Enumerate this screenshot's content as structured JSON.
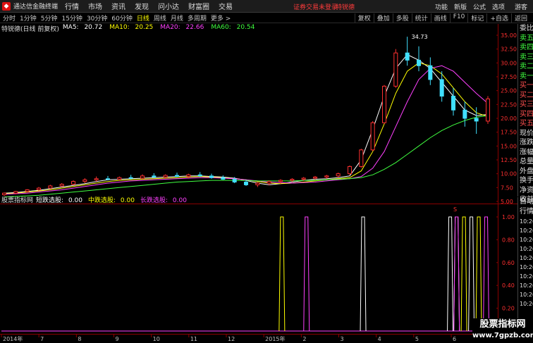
{
  "window": {
    "app_name": "通达信金融终端",
    "menu": [
      "行情",
      "市场",
      "资讯",
      "发现",
      "问小达",
      "财富圈",
      "交易"
    ],
    "notice": "证券交易未登录",
    "notice_stock": "特锐德",
    "right_menu": [
      "功能",
      "新版",
      "公式",
      "选项"
    ],
    "guest": "游客"
  },
  "toolbar": {
    "periods": [
      "分时",
      "1分钟",
      "5分钟",
      "15分钟",
      "30分钟",
      "60分钟",
      "日线",
      "周线",
      "月线",
      "多周期",
      "更多 >"
    ],
    "active_period": "日线",
    "right_tools": [
      "复权",
      "叠加",
      "多股",
      "统计",
      "画线",
      "F10",
      "标记",
      "+自选",
      "返回"
    ]
  },
  "main_chart": {
    "stock_label": "特锐德(日线 前复权)",
    "ma": [
      {
        "label": "MA5:",
        "value": "20.72",
        "color": "#ffffff"
      },
      {
        "label": "MA10:",
        "value": "20.25",
        "color": "#ffff00"
      },
      {
        "label": "MA20:",
        "value": "22.66",
        "color": "#ff40ff"
      },
      {
        "label": "MA60:",
        "value": "20.54",
        "color": "#40ff40"
      }
    ],
    "peak_label": "34.73",
    "marker_s": "S"
  },
  "indicator": {
    "name": "股票指标网",
    "items": [
      {
        "label": "短跌选股:",
        "value": "0.00",
        "color": "#ffffff"
      },
      {
        "label": "中跌选股:",
        "value": "0.00",
        "color": "#ffff00"
      },
      {
        "label": "长跌选股:",
        "value": "0.00",
        "color": "#ff40ff"
      }
    ]
  },
  "side_panel": {
    "top": [
      "委比",
      "卖五",
      "卖四",
      "卖三",
      "卖二",
      "卖一",
      "买一",
      "买二",
      "买三",
      "买四",
      "买五",
      "现价",
      "涨跌",
      "涨幅",
      "总量",
      "外盘",
      "换手",
      "净资",
      "收益"
    ],
    "bottom_title": [
      "自动",
      "行情"
    ],
    "times": [
      "10:26",
      "10:26",
      "10:26",
      "10:26",
      "10:26",
      "10:26",
      "10:26",
      "10:26",
      "10:26",
      "10:26"
    ]
  },
  "chart_data": {
    "type": "candlestick",
    "y_axis_ticks": [
      "35.00",
      "32.50",
      "30.00",
      "27.50",
      "25.00",
      "22.50",
      "20.00",
      "17.50",
      "15.00",
      "12.50",
      "10.00",
      "7.50",
      "5.00"
    ],
    "ylim": [
      5.0,
      35.0
    ],
    "indicator_y_ticks": [
      "1.00",
      "0.80",
      "0.60",
      "0.40",
      "0.20"
    ],
    "x_axis_labels": [
      "2014年",
      "7",
      "8",
      "9",
      "10",
      "11",
      "12",
      "2015年",
      "2",
      "3",
      "4",
      "5",
      "6"
    ],
    "ma_series": [
      {
        "name": "MA5",
        "color": "#ffffff",
        "values": [
          6.5,
          6.6,
          6.8,
          7.0,
          7.3,
          7.6,
          7.9,
          8.2,
          8.6,
          8.9,
          9.0,
          9.1,
          9.2,
          9.3,
          9.4,
          9.5,
          9.6,
          9.6,
          9.5,
          9.4,
          9.2,
          8.8,
          8.3,
          8.0,
          8.2,
          8.5,
          8.8,
          9.0,
          9.1,
          9.3,
          9.6,
          12.5,
          18.0,
          24.0,
          29.0,
          31.5,
          30.5,
          29.0,
          26.5,
          24.0,
          21.5,
          20.5,
          20.7
        ]
      },
      {
        "name": "MA10",
        "color": "#ffff00",
        "values": [
          6.4,
          6.5,
          6.7,
          6.9,
          7.1,
          7.4,
          7.7,
          8.0,
          8.3,
          8.6,
          8.8,
          8.9,
          9.0,
          9.1,
          9.2,
          9.3,
          9.4,
          9.5,
          9.4,
          9.3,
          9.1,
          8.9,
          8.6,
          8.3,
          8.2,
          8.3,
          8.5,
          8.7,
          8.9,
          9.1,
          9.3,
          10.5,
          14.0,
          19.0,
          24.5,
          28.5,
          30.0,
          29.5,
          28.0,
          25.5,
          23.0,
          21.0,
          20.3
        ]
      },
      {
        "name": "MA20",
        "color": "#ff40ff",
        "values": [
          6.3,
          6.4,
          6.5,
          6.7,
          6.9,
          7.1,
          7.4,
          7.7,
          8.0,
          8.3,
          8.5,
          8.7,
          8.8,
          8.9,
          9.0,
          9.1,
          9.2,
          9.3,
          9.3,
          9.2,
          9.1,
          8.9,
          8.7,
          8.5,
          8.4,
          8.3,
          8.4,
          8.5,
          8.7,
          8.9,
          9.1,
          9.5,
          11.0,
          14.0,
          18.5,
          23.0,
          27.0,
          29.0,
          29.5,
          28.5,
          26.5,
          24.5,
          22.7
        ]
      },
      {
        "name": "MA60",
        "color": "#40ff40",
        "values": [
          5.8,
          5.9,
          6.0,
          6.1,
          6.3,
          6.5,
          6.7,
          6.9,
          7.1,
          7.3,
          7.5,
          7.7,
          7.9,
          8.1,
          8.3,
          8.5,
          8.6,
          8.7,
          8.8,
          8.8,
          8.8,
          8.8,
          8.7,
          8.7,
          8.7,
          8.7,
          8.8,
          8.8,
          8.9,
          9.0,
          9.1,
          9.3,
          9.8,
          10.8,
          12.0,
          13.5,
          15.0,
          16.5,
          17.8,
          18.8,
          19.6,
          20.2,
          20.5
        ]
      }
    ],
    "candles": [
      {
        "o": 6.2,
        "h": 6.6,
        "l": 6.0,
        "c": 6.5
      },
      {
        "o": 6.5,
        "h": 6.9,
        "l": 6.3,
        "c": 6.8
      },
      {
        "o": 6.8,
        "h": 7.2,
        "l": 6.6,
        "c": 7.1
      },
      {
        "o": 7.1,
        "h": 7.6,
        "l": 6.9,
        "c": 7.4
      },
      {
        "o": 7.4,
        "h": 8.0,
        "l": 7.2,
        "c": 7.8
      },
      {
        "o": 7.8,
        "h": 8.3,
        "l": 7.6,
        "c": 8.1
      },
      {
        "o": 8.1,
        "h": 8.8,
        "l": 7.9,
        "c": 8.6
      },
      {
        "o": 8.6,
        "h": 9.2,
        "l": 8.3,
        "c": 8.9
      },
      {
        "o": 8.9,
        "h": 9.5,
        "l": 8.6,
        "c": 9.1
      },
      {
        "o": 9.1,
        "h": 9.6,
        "l": 8.8,
        "c": 9.0
      },
      {
        "o": 9.0,
        "h": 9.5,
        "l": 8.7,
        "c": 9.3
      },
      {
        "o": 9.3,
        "h": 9.8,
        "l": 9.0,
        "c": 9.2
      },
      {
        "o": 9.2,
        "h": 9.9,
        "l": 9.0,
        "c": 9.6
      },
      {
        "o": 9.6,
        "h": 10.1,
        "l": 9.2,
        "c": 9.4
      },
      {
        "o": 9.4,
        "h": 9.9,
        "l": 9.1,
        "c": 9.7
      },
      {
        "o": 9.7,
        "h": 10.2,
        "l": 9.4,
        "c": 9.5
      },
      {
        "o": 9.5,
        "h": 10.0,
        "l": 9.2,
        "c": 9.8
      },
      {
        "o": 9.8,
        "h": 10.3,
        "l": 9.4,
        "c": 9.6
      },
      {
        "o": 9.6,
        "h": 10.0,
        "l": 9.1,
        "c": 9.3
      },
      {
        "o": 9.3,
        "h": 9.7,
        "l": 8.9,
        "c": 9.0
      },
      {
        "o": 9.0,
        "h": 9.4,
        "l": 8.3,
        "c": 8.5
      },
      {
        "o": 8.5,
        "h": 8.9,
        "l": 7.8,
        "c": 8.0
      },
      {
        "o": 8.0,
        "h": 8.5,
        "l": 7.6,
        "c": 8.3
      },
      {
        "o": 8.3,
        "h": 8.8,
        "l": 7.9,
        "c": 8.6
      },
      {
        "o": 8.6,
        "h": 9.0,
        "l": 8.2,
        "c": 8.8
      },
      {
        "o": 8.8,
        "h": 9.2,
        "l": 8.5,
        "c": 9.0
      },
      {
        "o": 9.0,
        "h": 9.4,
        "l": 8.7,
        "c": 9.2
      },
      {
        "o": 9.2,
        "h": 9.6,
        "l": 8.9,
        "c": 9.4
      },
      {
        "o": 9.4,
        "h": 9.8,
        "l": 9.1,
        "c": 9.6
      },
      {
        "o": 9.6,
        "h": 10.2,
        "l": 9.3,
        "c": 10.0
      },
      {
        "o": 10.0,
        "h": 11.5,
        "l": 9.8,
        "c": 11.3
      },
      {
        "o": 11.3,
        "h": 14.5,
        "l": 11.1,
        "c": 14.3
      },
      {
        "o": 14.3,
        "h": 19.5,
        "l": 14.1,
        "c": 19.2
      },
      {
        "o": 19.2,
        "h": 26.0,
        "l": 19.0,
        "c": 25.8
      },
      {
        "o": 25.8,
        "h": 32.5,
        "l": 25.5,
        "c": 31.8
      },
      {
        "o": 31.8,
        "h": 34.73,
        "l": 29.5,
        "c": 30.5
      },
      {
        "o": 30.5,
        "h": 33.0,
        "l": 28.5,
        "c": 29.5
      },
      {
        "o": 29.5,
        "h": 31.0,
        "l": 26.0,
        "c": 27.0
      },
      {
        "o": 27.0,
        "h": 28.5,
        "l": 23.0,
        "c": 24.0
      },
      {
        "o": 24.0,
        "h": 25.5,
        "l": 20.5,
        "c": 21.5
      },
      {
        "o": 21.5,
        "h": 23.0,
        "l": 18.5,
        "c": 20.0
      },
      {
        "o": 20.0,
        "h": 22.0,
        "l": 17.2,
        "c": 19.5
      },
      {
        "o": 19.5,
        "h": 24.0,
        "l": 19.0,
        "c": 23.5
      }
    ],
    "signals": {
      "short": [
        {
          "x": 0.735,
          "v": 1.0
        },
        {
          "x": 0.912,
          "v": 1.0
        },
        {
          "x": 0.925,
          "v": 1.0
        },
        {
          "x": 0.955,
          "v": 1.0
        }
      ],
      "mid": [
        {
          "x": 0.57,
          "v": 1.0
        },
        {
          "x": 0.94,
          "v": 1.0
        },
        {
          "x": 0.97,
          "v": 1.0
        }
      ],
      "long": [
        {
          "x": 0.62,
          "v": 1.0
        },
        {
          "x": 0.925,
          "v": 1.0
        },
        {
          "x": 0.985,
          "v": 1.0
        }
      ]
    }
  }
}
